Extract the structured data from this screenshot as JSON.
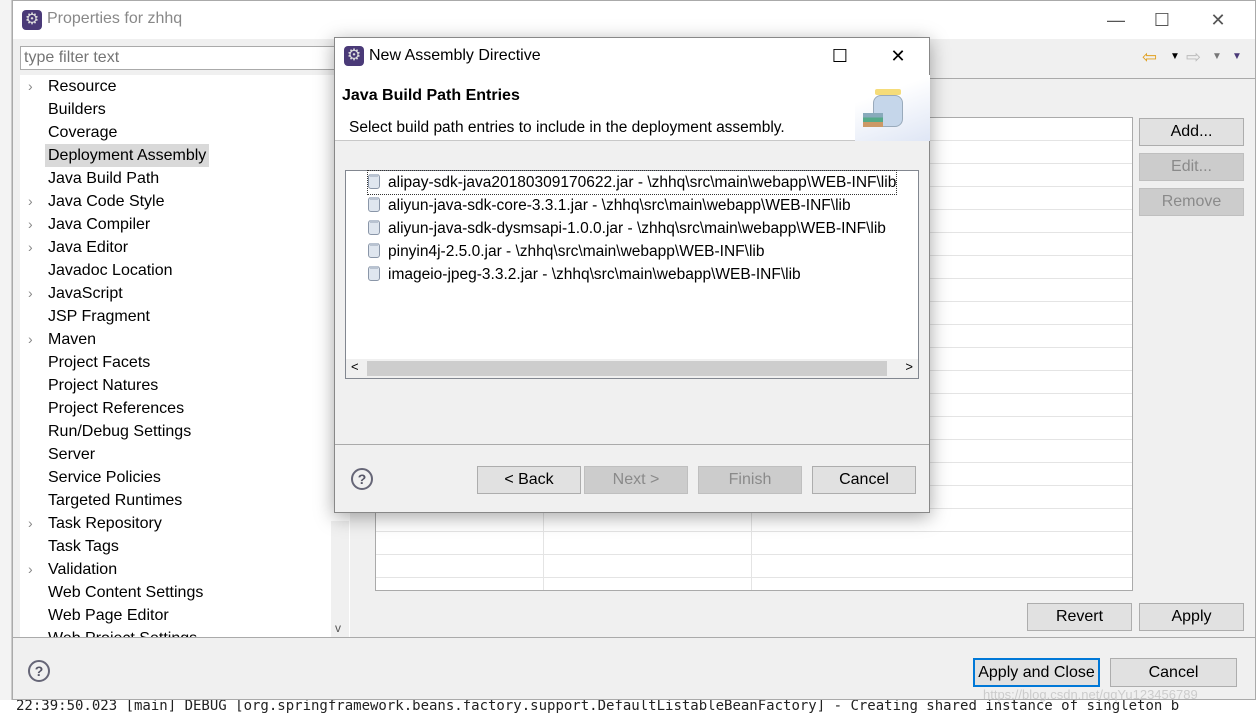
{
  "background": {
    "log_line": "22:39:50.023 [main] DEBUG [org.springframework.beans.factory.support.DefaultListableBeanFactory] - Creating shared instance of singleton b",
    "watermark": "https://blog.csdn.net/qqYu123456789"
  },
  "properties": {
    "title": "Properties for zhhq",
    "filter_placeholder": "type filter text",
    "tree": [
      {
        "label": "Resource",
        "expandable": true
      },
      {
        "label": "Builders"
      },
      {
        "label": "Coverage"
      },
      {
        "label": "Deployment Assembly",
        "selected": true
      },
      {
        "label": "Java Build Path"
      },
      {
        "label": "Java Code Style",
        "expandable": true
      },
      {
        "label": "Java Compiler",
        "expandable": true
      },
      {
        "label": "Java Editor",
        "expandable": true
      },
      {
        "label": "Javadoc Location"
      },
      {
        "label": "JavaScript",
        "expandable": true
      },
      {
        "label": "JSP Fragment"
      },
      {
        "label": "Maven",
        "expandable": true
      },
      {
        "label": "Project Facets"
      },
      {
        "label": "Project Natures"
      },
      {
        "label": "Project References"
      },
      {
        "label": "Run/Debug Settings"
      },
      {
        "label": "Server"
      },
      {
        "label": "Service Policies"
      },
      {
        "label": "Targeted Runtimes"
      },
      {
        "label": "Task Repository",
        "expandable": true
      },
      {
        "label": "Task Tags"
      },
      {
        "label": "Validation",
        "expandable": true
      },
      {
        "label": "Web Content Settings"
      },
      {
        "label": "Web Page Editor"
      },
      {
        "label": "Web Project Settings"
      }
    ],
    "side_buttons": {
      "add": "Add...",
      "edit": "Edit...",
      "remove": "Remove"
    },
    "revert": "Revert",
    "apply": "Apply",
    "apply_close": "Apply and Close",
    "cancel": "Cancel"
  },
  "dialog": {
    "title": "New Assembly Directive",
    "heading": "Java Build Path Entries",
    "description": "Select build path entries to include in the deployment assembly.",
    "entries": [
      "alipay-sdk-java20180309170622.jar - \\zhhq\\src\\main\\webapp\\WEB-INF\\lib",
      "aliyun-java-sdk-core-3.3.1.jar - \\zhhq\\src\\main\\webapp\\WEB-INF\\lib",
      "aliyun-java-sdk-dysmsapi-1.0.0.jar - \\zhhq\\src\\main\\webapp\\WEB-INF\\lib",
      "pinyin4j-2.5.0.jar - \\zhhq\\src\\main\\webapp\\WEB-INF\\lib",
      "imageio-jpeg-3.3.2.jar - \\zhhq\\src\\main\\webapp\\WEB-INF\\lib"
    ],
    "buttons": {
      "back": "< Back",
      "next": "Next >",
      "finish": "Finish",
      "cancel": "Cancel"
    }
  },
  "colors": {
    "accent": "#0078d7",
    "selection": "#d9d9d9",
    "disabled_button": "#cccccc"
  }
}
